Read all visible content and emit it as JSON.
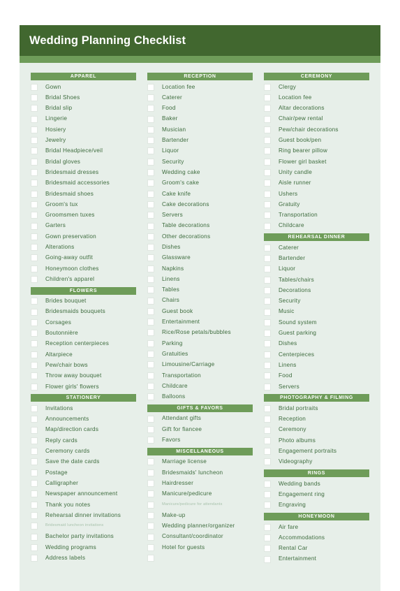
{
  "header": {
    "title": "Wedding Planning Checklist"
  },
  "theme": {
    "header_green": "#41672f",
    "accent_green": "#6e9c59",
    "sheet_background": "#e7efe9",
    "text_green": "#3d6b3d",
    "faint_text": "#a8c2ac"
  },
  "columns": [
    {
      "name": "column-left",
      "sections": [
        {
          "heading": "APPAREL",
          "items": [
            {
              "label": "Gown",
              "checked": false
            },
            {
              "label": "Bridal Shoes",
              "checked": false
            },
            {
              "label": "Bridal slip",
              "checked": false
            },
            {
              "label": "Lingerie",
              "checked": false
            },
            {
              "label": "Hosiery",
              "checked": false
            },
            {
              "label": "Jewelry",
              "checked": false
            },
            {
              "label": "Bridal Headpiece/veil",
              "checked": false
            },
            {
              "label": "Bridal gloves",
              "checked": false
            },
            {
              "label": "Bridesmaid dresses",
              "checked": false
            },
            {
              "label": "Bridesmaid accessories",
              "checked": false
            },
            {
              "label": "Bridesmaid shoes",
              "checked": false
            },
            {
              "label": "Groom's tux",
              "checked": false
            },
            {
              "label": "Groomsmen tuxes",
              "checked": false
            },
            {
              "label": "Garters",
              "checked": false
            },
            {
              "label": "Gown preservation",
              "checked": false
            },
            {
              "label": "Alterations",
              "checked": false
            },
            {
              "label": "Going-away outfit",
              "checked": false
            },
            {
              "label": "Honeymoon clothes",
              "checked": false
            },
            {
              "label": "Children's apparel",
              "checked": false
            }
          ]
        },
        {
          "heading": "FLOWERS",
          "items": [
            {
              "label": "Brides bouquet",
              "checked": false
            },
            {
              "label": "Bridesmaids bouquets",
              "checked": false
            },
            {
              "label": "Corsages",
              "checked": false
            },
            {
              "label": "Boutonnière",
              "checked": false
            },
            {
              "label": "Reception centerpieces",
              "checked": false
            },
            {
              "label": "Altarpiece",
              "checked": false
            },
            {
              "label": "Pew/chair bows",
              "checked": false
            },
            {
              "label": "Throw away bouquet",
              "checked": false
            },
            {
              "label": "Flower girls' flowers",
              "checked": false
            }
          ]
        },
        {
          "heading": "STATIONERY",
          "items": [
            {
              "label": "Invitations",
              "checked": false
            },
            {
              "label": "Announcements",
              "checked": false
            },
            {
              "label": "Map/direction cards",
              "checked": false
            },
            {
              "label": "Reply cards",
              "checked": false
            },
            {
              "label": "Ceremony cards",
              "checked": false
            },
            {
              "label": "Save the date cards",
              "checked": false
            },
            {
              "label": "Postage",
              "checked": false
            },
            {
              "label": "Calligrapher",
              "checked": false
            },
            {
              "label": "Newspaper announcement",
              "checked": false
            },
            {
              "label": "Thank you notes",
              "checked": false
            },
            {
              "label": "Rehearsal dinner invitations",
              "checked": false
            },
            {
              "label": "Bridesmaid luncheon invitations",
              "checked": false,
              "faint": true
            },
            {
              "label": "Bachelor party invitations",
              "checked": false
            },
            {
              "label": "Wedding programs",
              "checked": false
            },
            {
              "label": "Address labels",
              "checked": false
            }
          ]
        }
      ]
    },
    {
      "name": "column-middle",
      "sections": [
        {
          "heading": "RECEPTION",
          "items": [
            {
              "label": "Location fee",
              "checked": false
            },
            {
              "label": "Caterer",
              "checked": false
            },
            {
              "label": "Food",
              "checked": false
            },
            {
              "label": "Baker",
              "checked": false
            },
            {
              "label": "Musician",
              "checked": false
            },
            {
              "label": "Bartender",
              "checked": false
            },
            {
              "label": "Liquor",
              "checked": false
            },
            {
              "label": "Security",
              "checked": false
            },
            {
              "label": "Wedding cake",
              "checked": false
            },
            {
              "label": "Groom's cake",
              "checked": false
            },
            {
              "label": "Cake knife",
              "checked": false
            },
            {
              "label": "Cake decorations",
              "checked": false
            },
            {
              "label": "Servers",
              "checked": false
            },
            {
              "label": "Table decorations",
              "checked": false
            },
            {
              "label": "Other decorations",
              "checked": false
            },
            {
              "label": "Dishes",
              "checked": false
            },
            {
              "label": "Glassware",
              "checked": false
            },
            {
              "label": "Napkins",
              "checked": false
            },
            {
              "label": "Linens",
              "checked": false
            },
            {
              "label": "Tables",
              "checked": false
            },
            {
              "label": "Chairs",
              "checked": false
            },
            {
              "label": "Guest book",
              "checked": false
            },
            {
              "label": "Entertainment",
              "checked": false
            },
            {
              "label": "Rice/Rose petals/bubbles",
              "checked": false
            },
            {
              "label": "Parking",
              "checked": false
            },
            {
              "label": "Gratuities",
              "checked": false
            },
            {
              "label": "Limousine/Carriage",
              "checked": false
            },
            {
              "label": "Transportation",
              "checked": false
            },
            {
              "label": "Childcare",
              "checked": false
            },
            {
              "label": "Balloons",
              "checked": false
            }
          ]
        },
        {
          "heading": "GIFTS & FAVORS",
          "items": [
            {
              "label": "Attendant gifts",
              "checked": false
            },
            {
              "label": "Gift for fiancee",
              "checked": false
            },
            {
              "label": "Favors",
              "checked": false
            }
          ]
        },
        {
          "heading": "MISCELLANEOUS",
          "items": [
            {
              "label": "Marriage license",
              "checked": false
            },
            {
              "label": "Bridesmaids' luncheon",
              "checked": false
            },
            {
              "label": "Hairdresser",
              "checked": false
            },
            {
              "label": "Manicure/pedicure",
              "checked": false
            },
            {
              "label": "Manicure/pedicure for attendants",
              "checked": false,
              "faint": true
            },
            {
              "label": "Make-up",
              "checked": false
            },
            {
              "label": "Wedding planner/organizer",
              "checked": false
            },
            {
              "label": "Consultant/coordinator",
              "checked": false
            },
            {
              "label": "Hotel for guests",
              "checked": false
            },
            {
              "label": "",
              "checked": false,
              "blank": true
            }
          ]
        }
      ]
    },
    {
      "name": "column-right",
      "sections": [
        {
          "heading": "CEREMONY",
          "items": [
            {
              "label": "Clergy",
              "checked": false
            },
            {
              "label": "Location fee",
              "checked": false
            },
            {
              "label": "Altar decorations",
              "checked": false
            },
            {
              "label": "Chair/pew rental",
              "checked": false
            },
            {
              "label": "Pew/chair decorations",
              "checked": false
            },
            {
              "label": "Guest book/pen",
              "checked": false
            },
            {
              "label": "Ring bearer pillow",
              "checked": false
            },
            {
              "label": "Flower girl basket",
              "checked": false
            },
            {
              "label": "Unity candle",
              "checked": false
            },
            {
              "label": "Aisle runner",
              "checked": false
            },
            {
              "label": "Ushers",
              "checked": false
            },
            {
              "label": "Gratuity",
              "checked": false
            },
            {
              "label": "Transportation",
              "checked": false
            },
            {
              "label": "Childcare",
              "checked": false
            }
          ]
        },
        {
          "heading": "REHEARSAL DINNER",
          "items": [
            {
              "label": "Caterer",
              "checked": false
            },
            {
              "label": "Bartender",
              "checked": false
            },
            {
              "label": "Liquor",
              "checked": false
            },
            {
              "label": "Tables/chairs",
              "checked": false
            },
            {
              "label": "Decorations",
              "checked": false
            },
            {
              "label": "Security",
              "checked": false
            },
            {
              "label": "Music",
              "checked": false
            },
            {
              "label": "Sound system",
              "checked": false
            },
            {
              "label": "Guest parking",
              "checked": false
            },
            {
              "label": "Dishes",
              "checked": false
            },
            {
              "label": "Centerpieces",
              "checked": false
            },
            {
              "label": "Linens",
              "checked": false
            },
            {
              "label": "Food",
              "checked": false
            },
            {
              "label": "Servers",
              "checked": false
            }
          ]
        },
        {
          "heading": "PHOTOGRAPHY & FILMING",
          "items": [
            {
              "label": "Bridal portraits",
              "checked": false
            },
            {
              "label": "Reception",
              "checked": false
            },
            {
              "label": "Ceremony",
              "checked": false
            },
            {
              "label": "Photo albums",
              "checked": false
            },
            {
              "label": "Engagement portraits",
              "checked": false
            },
            {
              "label": "Videography",
              "checked": false
            }
          ]
        },
        {
          "heading": "RINGS",
          "items": [
            {
              "label": "Wedding bands",
              "checked": false
            },
            {
              "label": "Engagement ring",
              "checked": false
            },
            {
              "label": "Engraving",
              "checked": false
            }
          ]
        },
        {
          "heading": "HONEYMOON",
          "items": [
            {
              "label": "Air fare",
              "checked": false
            },
            {
              "label": "Accommodations",
              "checked": false
            },
            {
              "label": "Rental Car",
              "checked": false
            },
            {
              "label": "Entertainment",
              "checked": false
            }
          ]
        }
      ]
    }
  ]
}
